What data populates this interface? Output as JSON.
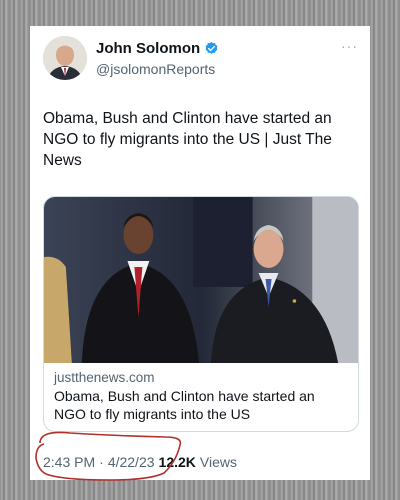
{
  "author": {
    "name": "John Solomon",
    "handle": "@jsolomonReports",
    "verified_color": "#1d9bf0"
  },
  "menu": {
    "icon": "more-horizontal-icon",
    "label": "···"
  },
  "tweet": {
    "text": "Obama, Bush and Clinton have started an NGO to fly migrants into the US  | Just The News"
  },
  "link_card": {
    "domain": "justthenews.com",
    "title": "Obama, Bush and Clinton have started an NGO to fly migrants into the US"
  },
  "meta": {
    "time": "2:43 PM",
    "separator": "·",
    "date": "4/22/23",
    "views_count": "12.2K",
    "views_label": "Views"
  },
  "annotation": {
    "color": "#b0302a"
  }
}
